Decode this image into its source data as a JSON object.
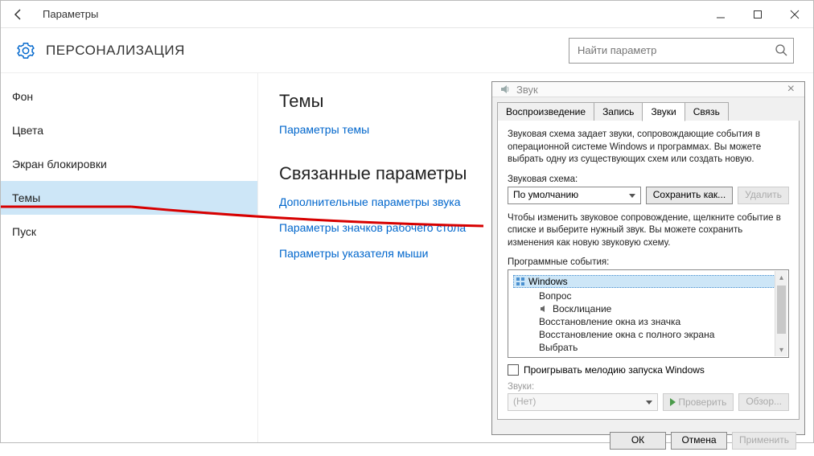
{
  "titlebar": {
    "title": "Параметры"
  },
  "header": {
    "title": "ПЕРСОНАЛИЗАЦИЯ",
    "search_placeholder": "Найти параметр"
  },
  "sidebar": {
    "items": [
      {
        "label": "Фон"
      },
      {
        "label": "Цвета"
      },
      {
        "label": "Экран блокировки"
      },
      {
        "label": "Темы"
      },
      {
        "label": "Пуск"
      }
    ]
  },
  "content": {
    "section1_title": "Темы",
    "link_theme": "Параметры темы",
    "section2_title": "Связанные параметры",
    "link_sound": "Дополнительные параметры звука",
    "link_icons": "Параметры значков рабочего стола",
    "link_cursor": "Параметры указателя мыши"
  },
  "sound_dlg": {
    "title": "Звук",
    "tabs": {
      "playback": "Воспроизведение",
      "record": "Запись",
      "sounds": "Звуки",
      "comm": "Связь"
    },
    "desc": "Звуковая схема задает звуки, сопровождающие события в операционной системе Windows и программах. Вы можете выбрать одну из существующих схем или создать новую.",
    "scheme_label": "Звуковая схема:",
    "scheme_value": "По умолчанию",
    "save_as": "Сохранить как...",
    "delete": "Удалить",
    "desc2": "Чтобы изменить звуковое сопровождение, щелкните событие в списке и выберите нужный звук. Вы можете сохранить изменения как новую звуковую схему.",
    "events_label": "Программные события:",
    "tree": {
      "root": "Windows",
      "items": [
        "Вопрос",
        "Восклицание",
        "Восстановление окна из значка",
        "Восстановление окна с полного экрана",
        "Выбрать"
      ]
    },
    "play_startup": "Проигрывать мелодию запуска Windows",
    "sounds_label": "Звуки:",
    "sound_value": "(Нет)",
    "test": "Проверить",
    "browse": "Обзор...",
    "ok": "ОК",
    "cancel": "Отмена",
    "apply": "Применить"
  }
}
